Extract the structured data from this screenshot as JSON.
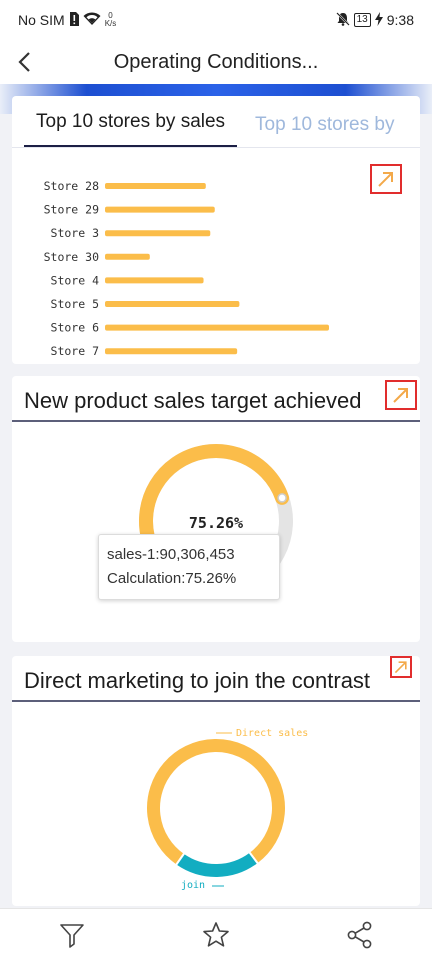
{
  "status_bar": {
    "carrier": "No SIM",
    "net_speed_value": "0",
    "net_speed_unit": "K/s",
    "battery": "13",
    "time": "9:38"
  },
  "header": {
    "title": "Operating Conditions..."
  },
  "card1": {
    "tabs": [
      {
        "label": "Top 10 stores by sales"
      },
      {
        "label": "Top 10 stores by"
      }
    ]
  },
  "card2": {
    "title": "New product sales target achieved",
    "tooltip": {
      "line1": "sales-1:90,306,453",
      "line2": "Calculation:75.26%"
    }
  },
  "card3": {
    "title": "Direct marketing to join the contrast"
  },
  "chart_data": [
    {
      "type": "bar",
      "orientation": "horizontal",
      "categories": [
        "Store 28",
        "Store 29",
        "Store 3",
        "Store 30",
        "Store 4",
        "Store 5",
        "Store 6",
        "Store 7"
      ],
      "values": [
        45,
        49,
        47,
        20,
        44,
        60,
        100,
        59
      ],
      "color": "#fbbd4a",
      "grid": false
    },
    {
      "type": "pie",
      "style": "gauge",
      "value": 75.26,
      "max": 100,
      "center_label": "75.26%",
      "color": "#fbbd4a",
      "track_color": "#e4e4e4"
    },
    {
      "type": "pie",
      "style": "donut",
      "slices": [
        {
          "label": "Direct sales",
          "value": 80,
          "color": "#fbbd4a"
        },
        {
          "label": "join",
          "value": 20,
          "color": "#12adc1"
        }
      ]
    }
  ],
  "colors": {
    "accent": "#1c1f45",
    "tab_inactive": "#9fb8dc",
    "expand_border": "#e12d2d",
    "expand_arrow": "#f3a94a"
  }
}
